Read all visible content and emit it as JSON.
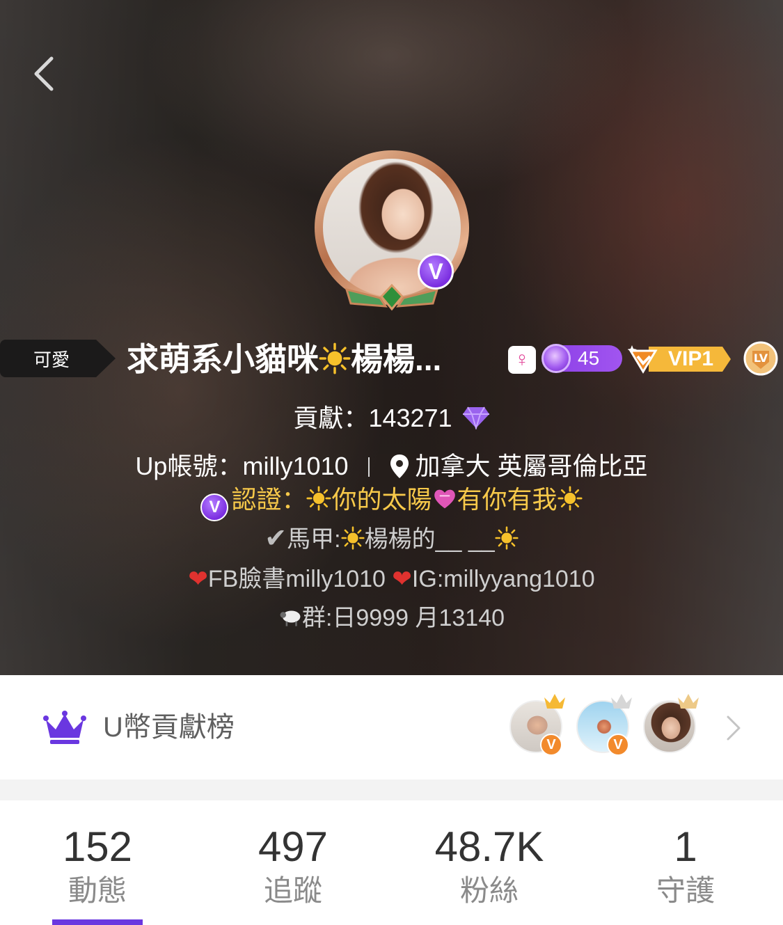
{
  "profile": {
    "tag": "可愛",
    "name_part1": "求萌系小貓咪",
    "name_part2": "楊楊...",
    "gender_symbol": "♀",
    "level": "45",
    "vip_label": "VIP1",
    "contribution_label": "貢獻：",
    "contribution_value": "143271",
    "account": "Up帳號：milly1010",
    "location": "加拿大 英屬哥倫比亞",
    "cert_badge": "V",
    "cert_label": "認證：",
    "cert_text1": "你的太陽",
    "cert_text2": "有你有我",
    "bio_line1_prefix": "馬甲:",
    "bio_line1_mid": "楊楊的__ __",
    "bio_line2_a": "FB臉書milly1010",
    "bio_line2_b": "IG:millyyang1010",
    "bio_line3": "群:日9999 月13140",
    "avatar_badge": "V"
  },
  "ranking": {
    "title": "U幣貢獻榜",
    "badge_letter": "V"
  },
  "stats": [
    {
      "value": "152",
      "label": "動態"
    },
    {
      "value": "497",
      "label": "追蹤"
    },
    {
      "value": "48.7K",
      "label": "粉絲"
    },
    {
      "value": "1",
      "label": "守護"
    }
  ],
  "colors": {
    "accent": "#6a37e0",
    "cert_text": "#f7c94a",
    "vip_orange": "#f28a2c"
  }
}
